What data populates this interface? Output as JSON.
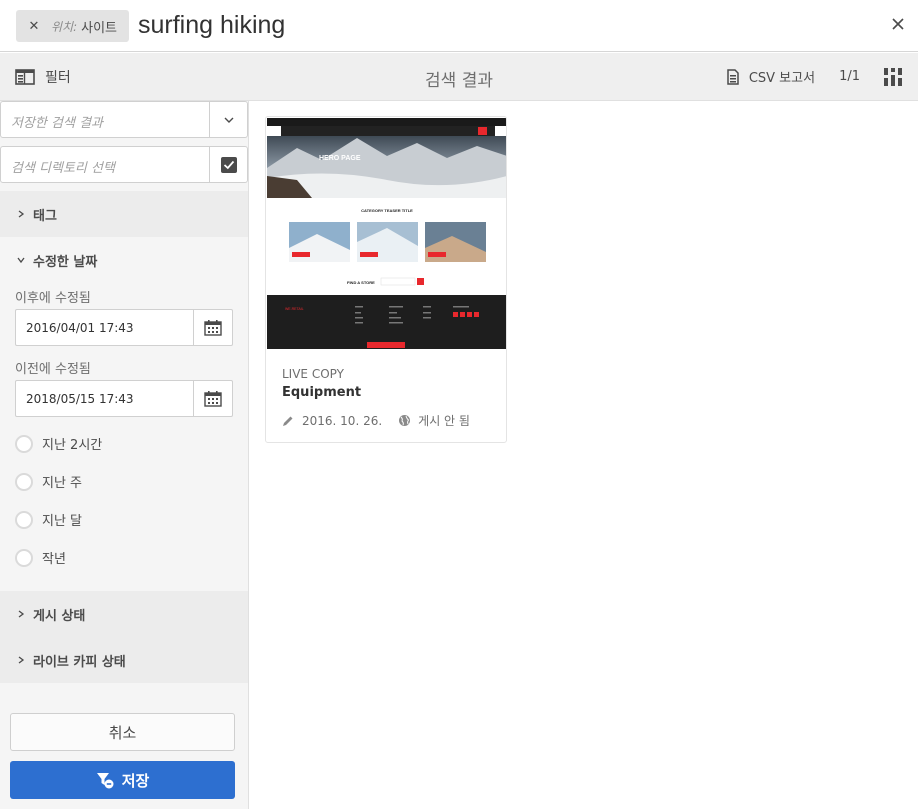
{
  "search": {
    "tag_label": "위치:",
    "tag_value": "사이트",
    "query": "surfing hiking"
  },
  "actionbar": {
    "filter_label": "필터",
    "title": "검색 결과",
    "csv_label": "CSV 보고서",
    "count": "1/1"
  },
  "rail": {
    "saved_search_placeholder": "저장한 검색 결과",
    "directory_placeholder": "검색 디렉토리 선택",
    "tags_label": "태그",
    "modified_label": "수정한 날짜",
    "after_label": "이후에 수정됨",
    "after_value": "2016/04/01 17:43",
    "before_label": "이전에 수정됨",
    "before_value": "2018/05/15 17:43",
    "radios": [
      {
        "label": "지난 2시간"
      },
      {
        "label": "지난 주"
      },
      {
        "label": "지난 달"
      },
      {
        "label": "작년"
      }
    ],
    "publish_status_label": "게시 상태",
    "livecopy_status_label": "라이브 카피 상태",
    "cancel_label": "취소",
    "save_label": "저장"
  },
  "results": [
    {
      "type": "LIVE COPY",
      "title": "Equipment",
      "modified": "2016. 10. 26.",
      "status": "게시 안 됨",
      "thumbnail": {
        "hero_text": "HERO PAGE",
        "teaser_title": "CATEGORY TEASER TITLE",
        "find_store": "FIND A STORE",
        "brand": "WE.RETAIL"
      }
    }
  ],
  "colors": {
    "accent": "#2d6fd0",
    "brand_red": "#e8282d",
    "rail_bg": "#f5f5f5"
  }
}
